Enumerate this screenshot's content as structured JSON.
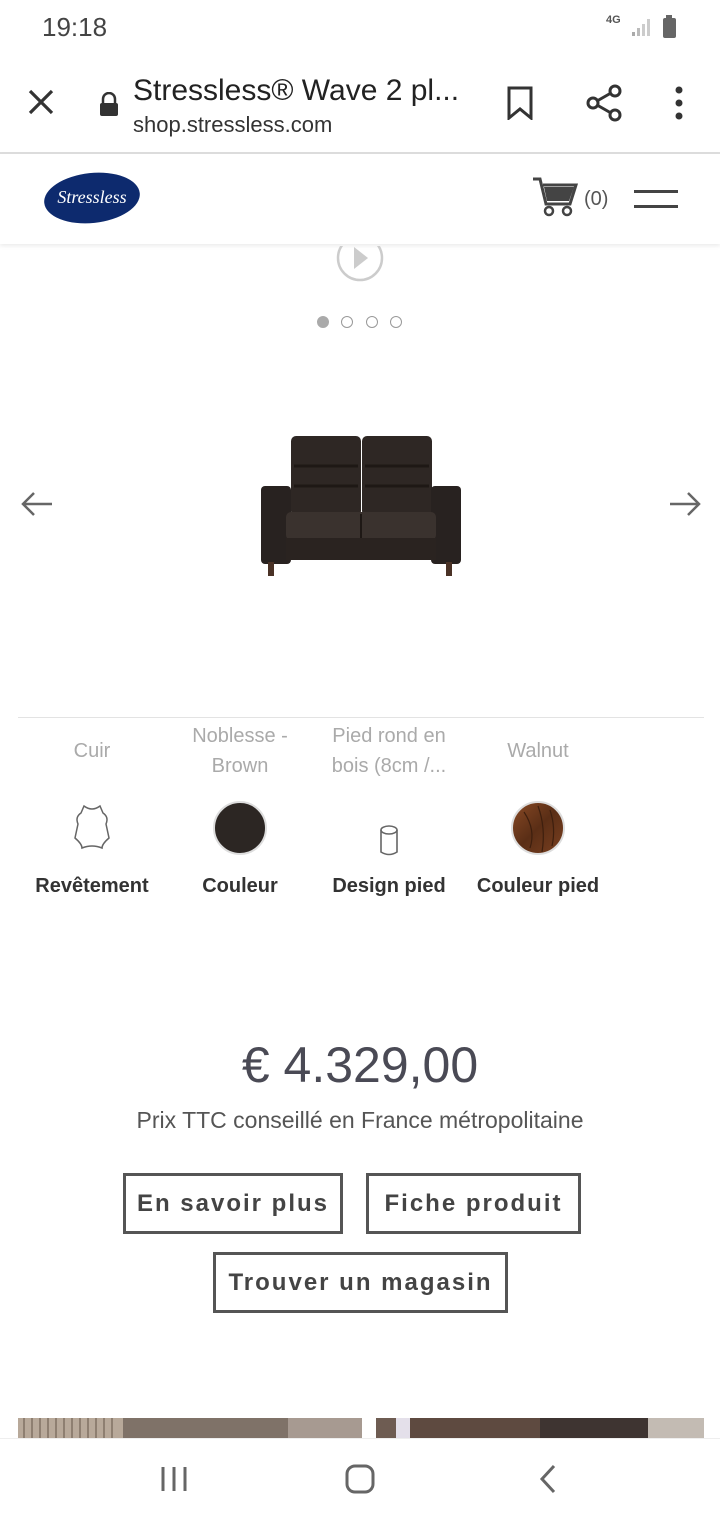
{
  "status_bar": {
    "time": "19:18",
    "network": "4G"
  },
  "browser": {
    "page_title": "Stressless® Wave 2 pl...",
    "url": "shop.stressless.com"
  },
  "site": {
    "logo_text": "Stressless",
    "cart_count": "(0)"
  },
  "carousel": {
    "slides": 4,
    "active_index": 0
  },
  "options": [
    {
      "value": "Cuir",
      "label": "Revêtement",
      "icon": "leather-icon"
    },
    {
      "value_line1": "Noblesse -",
      "value_line2": "Brown",
      "label": "Couleur",
      "icon": "color-swatch",
      "swatch": "#2c2623"
    },
    {
      "value_line1": "Pied rond en",
      "value_line2": "bois (8cm /...",
      "label": "Design pied",
      "icon": "leg-icon"
    },
    {
      "value": "Walnut",
      "label": "Couleur pied",
      "icon": "walnut-swatch",
      "swatch": "#6b3a1f"
    }
  ],
  "price": {
    "amount": "€ 4.329,00",
    "note": "Prix TTC conseillé en France métropolitaine"
  },
  "buttons": {
    "learn_more": "En savoir plus",
    "product_sheet": "Fiche produit",
    "find_store": "Trouver un magasin"
  },
  "colors": {
    "brand": "#0d2a6e",
    "text": "#4a4a55"
  }
}
